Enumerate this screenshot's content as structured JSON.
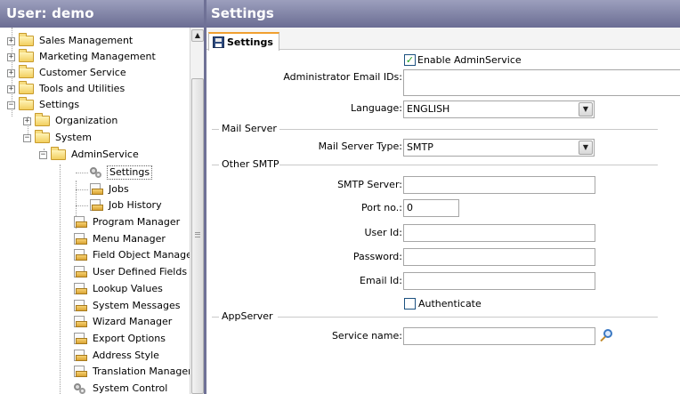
{
  "left_panel": {
    "title": "User: demo",
    "tree": [
      {
        "label": "Sales Management",
        "icon": "folder-icon",
        "expander": "+"
      },
      {
        "label": "Marketing Management",
        "icon": "folder-icon",
        "expander": "+"
      },
      {
        "label": "Customer Service",
        "icon": "folder-icon",
        "expander": "+"
      },
      {
        "label": "Tools and Utilities",
        "icon": "folder-icon",
        "expander": "+"
      },
      {
        "label": "Settings",
        "icon": "folder-icon",
        "expander": "−"
      },
      {
        "label": "Organization",
        "icon": "folder-icon",
        "expander": "+"
      },
      {
        "label": "System",
        "icon": "folder-icon",
        "expander": "−"
      },
      {
        "label": "AdminService",
        "icon": "folder-icon",
        "expander": "−"
      },
      {
        "label": "Settings",
        "icon": "gear-icon",
        "selected": true
      },
      {
        "label": "Jobs",
        "icon": "document-icon"
      },
      {
        "label": "Job History",
        "icon": "document-icon"
      },
      {
        "label": "Program Manager",
        "icon": "document-icon"
      },
      {
        "label": "Menu Manager",
        "icon": "document-icon"
      },
      {
        "label": "Field Object Manager",
        "icon": "document-icon"
      },
      {
        "label": "User Defined Fields",
        "icon": "document-icon"
      },
      {
        "label": "Lookup Values",
        "icon": "document-icon"
      },
      {
        "label": "System Messages",
        "icon": "document-icon"
      },
      {
        "label": "Wizard Manager",
        "icon": "document-icon"
      },
      {
        "label": "Export Options",
        "icon": "document-icon"
      },
      {
        "label": "Address Style",
        "icon": "document-icon"
      },
      {
        "label": "Translation Manager",
        "icon": "document-icon"
      },
      {
        "label": "System Control",
        "icon": "gear-icon"
      }
    ]
  },
  "right_panel": {
    "title": "Settings",
    "tab_label": "Settings",
    "enable_adminservice": {
      "label": "Enable AdminService",
      "checked": true,
      "mark": "✓"
    },
    "admin_email": {
      "label": "Administrator Email IDs:",
      "value": ""
    },
    "language": {
      "label": "Language:",
      "value": "ENGLISH"
    },
    "mail_server_section": "Mail Server",
    "mail_server_type": {
      "label": "Mail Server Type:",
      "value": "SMTP"
    },
    "other_smtp_section": "Other SMTP",
    "smtp_server": {
      "label": "SMTP Server:",
      "value": ""
    },
    "port": {
      "label": "Port no.:",
      "value": "0"
    },
    "user_id": {
      "label": "User Id:",
      "value": ""
    },
    "password": {
      "label": "Password:",
      "value": ""
    },
    "email_id": {
      "label": "Email Id:",
      "value": ""
    },
    "authenticate": {
      "label": "Authenticate",
      "checked": false,
      "mark": ""
    },
    "appserver_section": "AppServer",
    "service_name": {
      "label": "Service name:",
      "value": ""
    }
  },
  "colors": {
    "header_bg": "#7e80a6",
    "divider": "#6f7196",
    "tab_accent": "#f0a030",
    "check_mark": "#21a121"
  }
}
